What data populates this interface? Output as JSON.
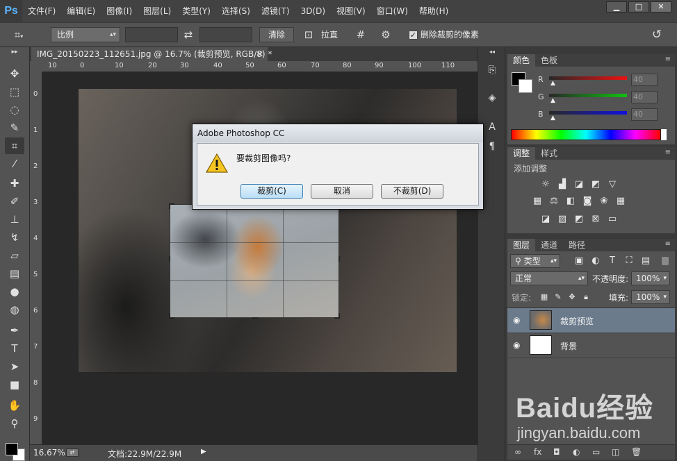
{
  "app": {
    "logo": "Ps",
    "menu": [
      "文件(F)",
      "编辑(E)",
      "图像(I)",
      "图层(L)",
      "类型(Y)",
      "选择(S)",
      "滤镜(T)",
      "3D(D)",
      "视图(V)",
      "窗口(W)",
      "帮助(H)"
    ],
    "window_controls": [
      "▁",
      "□",
      "✕"
    ]
  },
  "options_bar": {
    "tool_icon": "crop-tool-icon",
    "ratio_select": "比例",
    "clear_button": "清除",
    "straighten_label": "拉直",
    "delete_cropped_checked": true,
    "delete_cropped_label": "删除裁剪的像素"
  },
  "document": {
    "tab_title": "IMG_20150223_112651.jpg @ 16.7% (裁剪预览, RGB/8) *",
    "close_glyph": "✕",
    "ruler_h_labels": [
      "10",
      "0",
      "10",
      "20",
      "30",
      "40",
      "50",
      "60",
      "70",
      "80",
      "90",
      "100",
      "110"
    ],
    "ruler_v_labels": [
      "0",
      "1",
      "2",
      "3",
      "4",
      "5",
      "6",
      "7",
      "8",
      "9"
    ]
  },
  "status": {
    "zoom": "16.67%",
    "doc_info": "文档:22.9M/22.9M"
  },
  "color_panel": {
    "tabs": [
      "颜色",
      "色板"
    ],
    "channels": [
      {
        "label": "R",
        "value": "40",
        "gradient": "#f01010"
      },
      {
        "label": "G",
        "value": "40",
        "gradient": "#10c010"
      },
      {
        "label": "B",
        "value": "40",
        "gradient": "#1010e0"
      }
    ]
  },
  "adjust_panel": {
    "tabs": [
      "调整",
      "样式"
    ],
    "heading": "添加调整"
  },
  "layers_panel": {
    "tabs": [
      "图层",
      "通道",
      "路径"
    ],
    "filter_kind": "类型",
    "blend_mode": "正常",
    "opacity_label": "不透明度:",
    "opacity_value": "100%",
    "lock_label": "锁定:",
    "fill_label": "填充:",
    "fill_value": "100%",
    "layers": [
      {
        "name": "裁剪预览",
        "selected": true
      },
      {
        "name": "背景",
        "selected": false
      }
    ]
  },
  "dialog": {
    "title": "Adobe Photoshop CC",
    "message": "要裁剪图像吗?",
    "buttons": [
      "裁剪(C)",
      "取消",
      "不裁剪(D)"
    ]
  },
  "watermark": {
    "logo": "Baidu经验",
    "url": "jingyan.baidu.com"
  }
}
